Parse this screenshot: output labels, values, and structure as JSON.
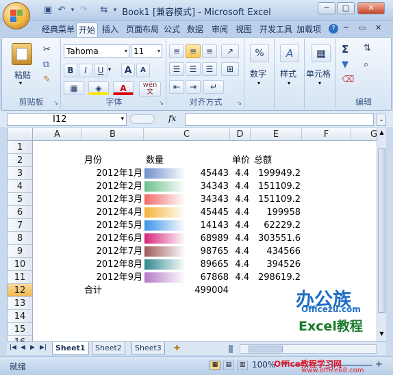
{
  "window": {
    "title": "Book1  [兼容模式] - Microsoft Excel",
    "min": "─",
    "max": "□",
    "close": "✕"
  },
  "tabs": [
    "经典菜单",
    "开始",
    "插入",
    "页面布局",
    "公式",
    "数据",
    "审阅",
    "视图",
    "开发工具",
    "加载项"
  ],
  "ribbon": {
    "clipboard": {
      "label": "剪贴板",
      "paste": "粘贴"
    },
    "font": {
      "label": "字体",
      "name": "Tahoma",
      "size": "11",
      "bold": "B",
      "italic": "I",
      "underline": "U",
      "grow": "A",
      "shrink": "A",
      "wen": "wén"
    },
    "alignment": {
      "label": "对齐方式"
    },
    "number": {
      "label": "数字",
      "symbol": "%"
    },
    "styles": {
      "label": "样式"
    },
    "cells": {
      "label": "单元格"
    },
    "editing": {
      "label": "编辑"
    }
  },
  "formula_bar": {
    "name_box": "I12",
    "fx": "fx",
    "value": ""
  },
  "grid": {
    "columns": [
      "A",
      "B",
      "C",
      "D",
      "E",
      "F",
      "G"
    ],
    "rows": [
      "1",
      "2",
      "3",
      "4",
      "5",
      "6",
      "7",
      "8",
      "9",
      "10",
      "11",
      "12",
      "13",
      "14",
      "15",
      "16"
    ],
    "selected_row": "12",
    "headers": {
      "month": "月份",
      "qty": "数量",
      "price": "单价",
      "total": "总额"
    },
    "data": [
      {
        "month": "2012年1月",
        "qty": "45443",
        "price": "4.4",
        "total": "199949.2",
        "color": "#6f8fca"
      },
      {
        "month": "2012年2月",
        "qty": "34343",
        "price": "4.4",
        "total": "151109.2",
        "color": "#6cc08a"
      },
      {
        "month": "2012年3月",
        "qty": "34343",
        "price": "4.4",
        "total": "151109.2",
        "color": "#f06a6a"
      },
      {
        "month": "2012年4月",
        "qty": "45445",
        "price": "4.4",
        "total": "199958",
        "color": "#f6b23a"
      },
      {
        "month": "2012年5月",
        "qty": "14143",
        "price": "4.4",
        "total": "62229.2",
        "color": "#3a93ea"
      },
      {
        "month": "2012年6月",
        "qty": "68989",
        "price": "4.4",
        "total": "303551.6",
        "color": "#d6257a"
      },
      {
        "month": "2012年7月",
        "qty": "98765",
        "price": "4.4",
        "total": "434566",
        "color": "#9e5a58"
      },
      {
        "month": "2012年8月",
        "qty": "89665",
        "price": "4.4",
        "total": "394526",
        "color": "#2f8a8f"
      },
      {
        "month": "2012年9月",
        "qty": "67868",
        "price": "4.4",
        "total": "298619.2",
        "color": "#b37ac6"
      }
    ],
    "total_label": "合计",
    "total_qty": "499004"
  },
  "sheets": [
    "Sheet1",
    "Sheet2",
    "Sheet3"
  ],
  "status": {
    "ready": "就绪",
    "zoom": "100%",
    "minus": "−",
    "plus": "+"
  },
  "watermark": {
    "brand": "办公族",
    "site": "Officezu.com",
    "course": "Excel教程",
    "site2": "Office教程学习网",
    "url2": "www.office68.com"
  }
}
